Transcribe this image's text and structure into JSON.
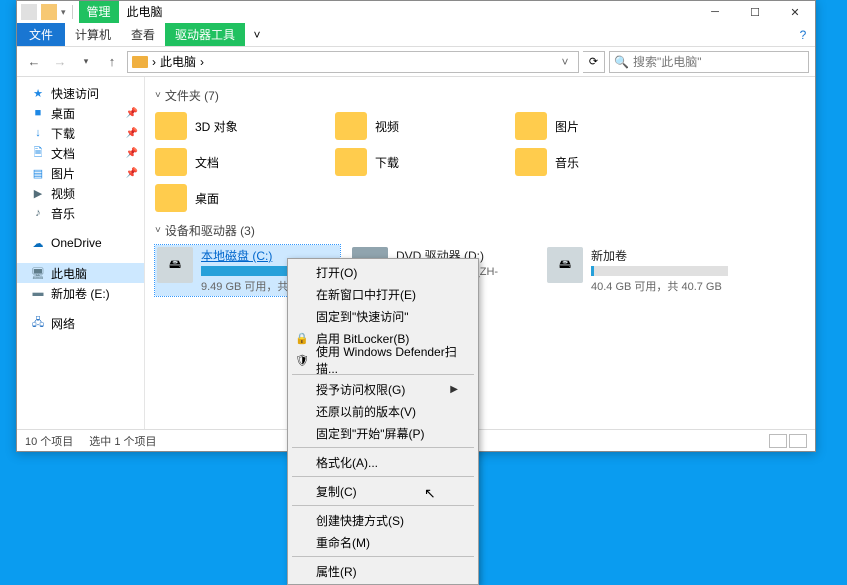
{
  "titlebar": {
    "manage_tab": "管理",
    "title": "此电脑"
  },
  "ribbon": {
    "file": "文件",
    "computer": "计算机",
    "view": "查看",
    "drive_tools": "驱动器工具"
  },
  "address": {
    "path": "此电脑",
    "sep": "›",
    "search_placeholder": "搜索\"此电脑\""
  },
  "nav": {
    "quick": "快速访问",
    "desktop": "桌面",
    "downloads": "下载",
    "documents": "文档",
    "pictures": "图片",
    "videos": "视频",
    "music": "音乐",
    "onedrive": "OneDrive",
    "thispc": "此电脑",
    "newvol": "新加卷 (E:)",
    "network": "网络"
  },
  "groups": {
    "folders_hdr": "文件夹 (7)",
    "drives_hdr": "设备和驱动器 (3)"
  },
  "folders": {
    "objects3d": "3D 对象",
    "videos": "视频",
    "pictures": "图片",
    "documents": "文档",
    "downloads": "下载",
    "music": "音乐",
    "desktop": "桌面"
  },
  "drives": {
    "c_name": "本地磁盘 (C:)",
    "c_free": "9.49 GB 可用，共 28.7 G",
    "c_fillpct": "66%",
    "dvd_name": "DVD 驱动器 (D:)",
    "dvd_sub": "CPBA_X64FRE_ZH-CN_DV9",
    "e_name": "新加卷",
    "e_free": "40.4 GB 可用，共 40.7 GB",
    "e_fillpct": "2%"
  },
  "status": {
    "count": "10 个项目",
    "selected": "选中 1 个项目"
  },
  "ctx": {
    "open": "打开(O)",
    "open_new": "在新窗口中打开(E)",
    "pin_quick": "固定到\"快速访问\"",
    "bitlocker": "启用 BitLocker(B)",
    "defender": "使用 Windows Defender扫描...",
    "access": "授予访问权限(G)",
    "restore_prev": "还原以前的版本(V)",
    "pin_start": "固定到\"开始\"屏幕(P)",
    "format": "格式化(A)...",
    "copy": "复制(C)",
    "shortcut": "创建快捷方式(S)",
    "rename": "重命名(M)",
    "properties": "属性(R)"
  }
}
